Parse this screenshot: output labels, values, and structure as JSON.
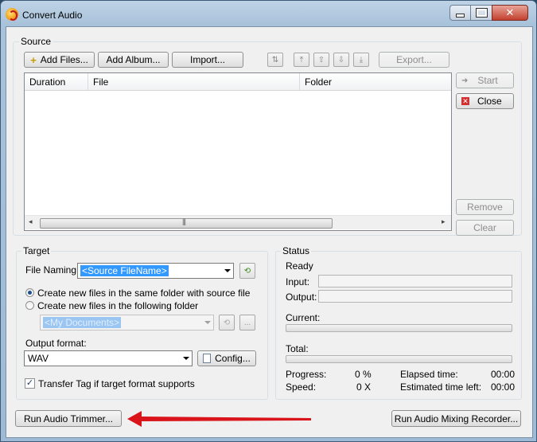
{
  "window": {
    "title": "Convert Audio"
  },
  "source": {
    "group_label": "Source",
    "add_files": "Add Files...",
    "add_album": "Add Album...",
    "import": "Import...",
    "export": "Export...",
    "columns": [
      "Duration",
      "File",
      "Folder"
    ]
  },
  "side_buttons": {
    "start": "Start",
    "close": "Close",
    "remove": "Remove",
    "clear": "Clear"
  },
  "target": {
    "group_label": "Target",
    "file_naming_label": "File Naming:",
    "file_naming_value": "<Source FileName>",
    "radio_same_folder": "Create new files in the same folder with source file",
    "radio_following_folder": "Create new files in the following folder",
    "folder_value": "<My Documents>",
    "browse_label": "...",
    "output_format_label": "Output format:",
    "output_format_value": "WAV",
    "config": "Config...",
    "transfer_tag": "Transfer Tag if target format supports",
    "transfer_tag_checked": true
  },
  "status": {
    "group_label": "Status",
    "state": "Ready",
    "input_label": "Input:",
    "output_label": "Output:",
    "current_label": "Current:",
    "total_label": "Total:",
    "progress_label": "Progress:",
    "progress_value": "0 %",
    "speed_label": "Speed:",
    "speed_value": "0 X",
    "elapsed_label": "Elapsed time:",
    "elapsed_value": "00:00",
    "estimated_label": "Estimated time left:",
    "estimated_value": "00:00"
  },
  "bottom": {
    "trimmer": "Run Audio Trimmer...",
    "mixing_recorder": "Run Audio Mixing Recorder..."
  },
  "colors": {
    "annotation_arrow": "#d9141a",
    "selection": "#3399ff"
  }
}
